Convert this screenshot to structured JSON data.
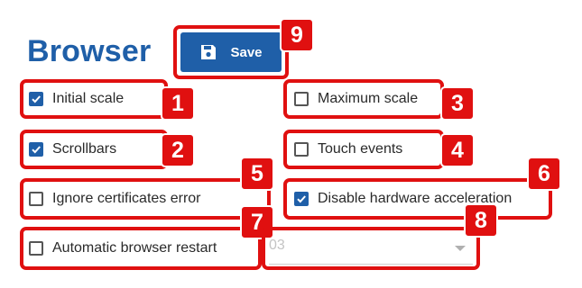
{
  "page": {
    "title": "Browser",
    "save_label": "Save"
  },
  "options": {
    "initial_scale": {
      "label": "Initial scale",
      "checked": true
    },
    "maximum_scale": {
      "label": "Maximum scale",
      "checked": false
    },
    "scrollbars": {
      "label": "Scrollbars",
      "checked": true
    },
    "touch_events": {
      "label": "Touch events",
      "checked": false
    },
    "ignore_cert": {
      "label": "Ignore certificates error",
      "checked": false
    },
    "disable_hw": {
      "label": "Disable hardware acceleration",
      "checked": true
    },
    "auto_restart": {
      "label": "Automatic browser restart",
      "checked": false
    }
  },
  "restart_select": {
    "value": "03"
  },
  "badges": [
    "1",
    "2",
    "3",
    "4",
    "5",
    "6",
    "7",
    "8",
    "9"
  ],
  "colors": {
    "accent": "#1f5fa8",
    "annotation": "#e01010"
  },
  "icons": {
    "save": "floppy-disk-icon",
    "check": "checkmark-icon",
    "dropdown": "chevron-down-icon"
  }
}
